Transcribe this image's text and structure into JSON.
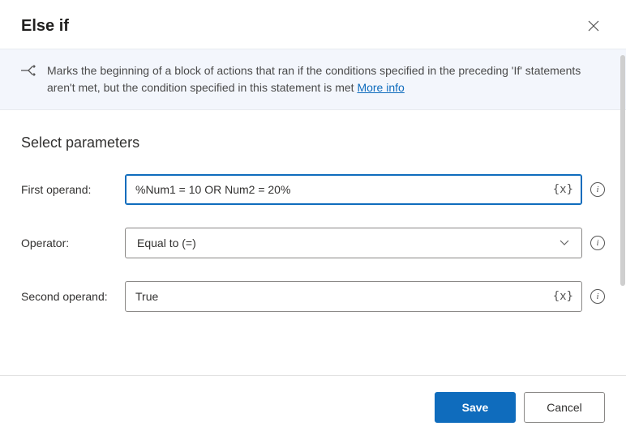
{
  "dialog": {
    "title": "Else if",
    "banner_text": "Marks the beginning of a block of actions that ran if the conditions specified in the preceding 'If' statements aren't met, but the condition specified in this statement is met ",
    "banner_link": "More info"
  },
  "section_title": "Select parameters",
  "fields": {
    "first_operand_label": "First operand:",
    "first_operand_value": "%Num1 = 10 OR Num2 = 20%",
    "operator_label": "Operator:",
    "operator_value": "Equal to (=)",
    "second_operand_label": "Second operand:",
    "second_operand_value": "True",
    "var_badge": "{x}"
  },
  "footer": {
    "save": "Save",
    "cancel": "Cancel"
  }
}
